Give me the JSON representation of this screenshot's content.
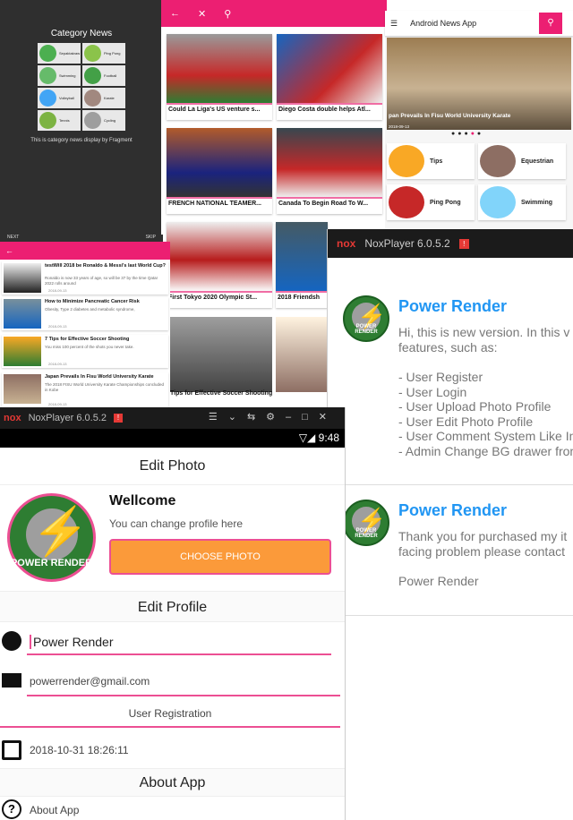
{
  "category_panel": {
    "title": "Category News",
    "items": [
      "Sepaktakraw",
      "Ping Pong",
      "Swimming",
      "Football",
      "Volleyball",
      "Karate",
      "Tennis",
      "Cycling"
    ],
    "description": "This is category news display by Fragment",
    "next": "NEXT",
    "skip": "SKIP"
  },
  "grid_panel": {
    "cards": [
      "Could La Liga's US venture s...",
      "Diego Costa double helps Atl...",
      "FRENCH NATIONAL TEAMER...",
      "Canada To Begin Road To W...",
      "First Tokyo 2020 Olympic St...",
      "2018 Friendsh",
      "Tips for Effective Soccer Shooting"
    ]
  },
  "app_panel": {
    "title": "Android News App",
    "hero_caption": "pan Prevails In Fisu World University Karate",
    "hero_date": "2018-09-13",
    "tiles": [
      "Tips",
      "Equestrian",
      "Ping Pong",
      "Swimming"
    ]
  },
  "list_panel": {
    "items": [
      {
        "title": "testWill 2018 be Ronaldo & Messi's last World Cup?",
        "summary": "Ronaldo is now 33 years of age, so will be 37 by the time Qatar 2022 rolls around",
        "date": "2018-09-13"
      },
      {
        "title": "How to Minimize Pancreatic Cancer Risk",
        "summary": "Obesity, Type 2 diabetes and metabolic syndrome,",
        "date": "2018-09-13"
      },
      {
        "title": "7 Tips for Effective Soccer Shooting",
        "summary": "You miss 100 percent of the shots you never take.",
        "date": "2018-09-13"
      },
      {
        "title": "Japan Prevails In Fisu World University Karate",
        "summary": "The 2018 FISU World University Karate Championships concluded in Kobe",
        "date": "2018-09-13"
      }
    ]
  },
  "nox_panel": {
    "window_title": "NoxPlayer 6.0.5.2",
    "logo_text": "POWER RENDER",
    "messages": [
      {
        "title": "Power Render",
        "lines": [
          "Hi, this is new version. In this v",
          "features, such as:",
          "",
          "- User Register",
          "- User Login",
          "- User Upload Photo Profile",
          "- User Edit Photo Profile",
          "- User Comment System Like In",
          "- Admin Change BG drawer from"
        ]
      },
      {
        "title": "Power Render",
        "lines": [
          "Thank you for purchased my it",
          "facing problem please contact",
          "",
          "Power Render"
        ]
      }
    ]
  },
  "edit_panel": {
    "window_title": "NoxPlayer 6.0.5.2",
    "time": "9:48",
    "edit_photo": "Edit Photo",
    "welcome": "Wellcome",
    "welcome_sub": "You can change profile here",
    "choose_photo": "CHOOSE PHOTO",
    "edit_profile": "Edit Profile",
    "name": "Power Render",
    "email": "powerrender@gmail.com",
    "registration": "User Registration",
    "date": "2018-10-31 18:26:11",
    "about_header": "About App",
    "about_item": "About App"
  },
  "colors": {
    "accent": "#ec1f72",
    "blue": "#2196f3",
    "orange": "#fb9a3a"
  }
}
